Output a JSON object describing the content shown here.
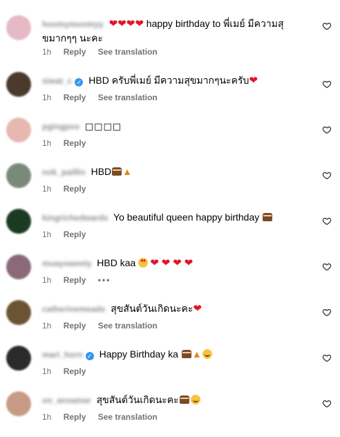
{
  "comments": [
    {
      "username": "hoomymoomyy",
      "verified": false,
      "prefix_emoji": [
        "heart",
        "heart",
        "heart",
        "heart"
      ],
      "text": "happy birthday to พี่เมย์ มีความสุ",
      "text_line2": "ขมากๆๆ นะคะ",
      "suffix_emoji": [],
      "time": "1h",
      "reply": "Reply",
      "translate": "See translation",
      "avatar_color": "#e6b9c6"
    },
    {
      "username": "siwat_c",
      "verified": true,
      "prefix_emoji": [],
      "text": "HBD ครับพี่เมย์ มีความสุขมากๆนะครับ",
      "suffix_emoji": [
        "heart"
      ],
      "time": "1h",
      "reply": "Reply",
      "translate": "See translation",
      "avatar_color": "#4a3a2c"
    },
    {
      "username": "pgingpov",
      "verified": false,
      "prefix_emoji": [],
      "text": "□□□□",
      "suffix_emoji": [],
      "time": "1h",
      "reply": "Reply",
      "translate": "",
      "avatar_color": "#e8b7b0"
    },
    {
      "username": "nok_paillin",
      "verified": false,
      "prefix_emoji": [],
      "text": "HBD",
      "suffix_emoji": [
        "cake",
        "popper"
      ],
      "time": "1h",
      "reply": "Reply",
      "translate": "",
      "avatar_color": "#7a8a78"
    },
    {
      "username": "kingrichedwards",
      "verified": false,
      "prefix_emoji": [],
      "text": "Yo beautiful queen happy birthday",
      "suffix_emoji": [
        "cake"
      ],
      "time": "1h",
      "reply": "Reply",
      "translate": "",
      "avatar_color": "#1b3a22"
    },
    {
      "username": "muaysweety",
      "verified": false,
      "prefix_emoji": [],
      "text": "HBD kaa",
      "suffix_emoji": [
        "starstruck",
        "heart",
        "heart",
        "heart",
        "heart"
      ],
      "time": "1h",
      "reply": "Reply",
      "translate": "",
      "more": "•••",
      "avatar_color": "#8a6a78"
    },
    {
      "username": "catherinemeads",
      "verified": false,
      "prefix_emoji": [],
      "text": "สุขสันต์วันเกิดนะคะ",
      "suffix_emoji": [
        "heart"
      ],
      "time": "1h",
      "reply": "Reply",
      "translate": "See translation",
      "avatar_color": "#6b5434"
    },
    {
      "username": "mari_horn",
      "verified": true,
      "prefix_emoji": [],
      "text": "Happy Birthday ka",
      "suffix_emoji": [
        "cake",
        "popper",
        "smile"
      ],
      "time": "1h",
      "reply": "Reply",
      "translate": "",
      "avatar_color": "#2a2a2a"
    },
    {
      "username": "on_ansamar",
      "verified": false,
      "prefix_emoji": [],
      "text": "สุขสันต์วันเกิดนะคะ",
      "suffix_emoji": [
        "cake",
        "smile"
      ],
      "time": "1h",
      "reply": "Reply",
      "translate": "See translation",
      "avatar_color": "#c79a84"
    }
  ],
  "colors": {
    "heart": "#e0162b",
    "meta_text": "#737373",
    "verified": "#3797f0"
  }
}
